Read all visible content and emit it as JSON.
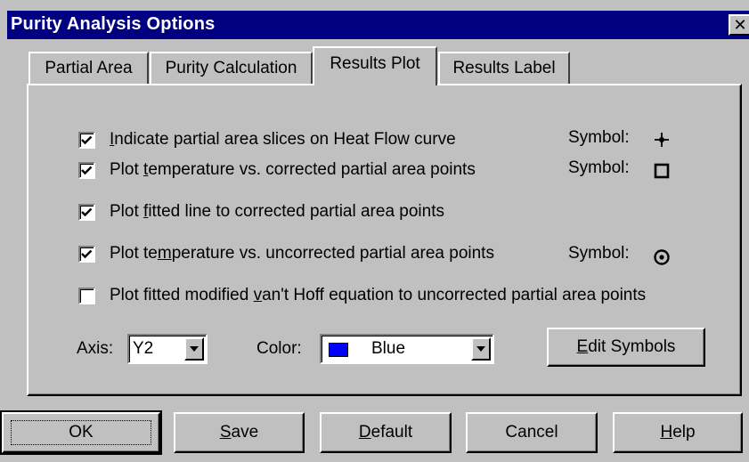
{
  "window": {
    "title": "Purity Analysis Options",
    "close_glyph": "✕"
  },
  "tabs": [
    {
      "label": "Partial Area",
      "active": false
    },
    {
      "label": "Purity Calculation",
      "active": false
    },
    {
      "label": "Results Plot",
      "active": true
    },
    {
      "label": "Results Label",
      "active": false
    }
  ],
  "options": [
    {
      "pre": "",
      "mn": "I",
      "post": "ndicate partial area slices on Heat Flow curve",
      "checked": true,
      "symbol_label": "Symbol:",
      "symbol": "crosshair-icon"
    },
    {
      "pre": "Plot ",
      "mn": "t",
      "post": "emperature vs. corrected partial area points",
      "checked": true,
      "symbol_label": "Symbol:",
      "symbol": "square-icon"
    },
    {
      "pre": "Plot ",
      "mn": "f",
      "post": "itted line to corrected partial area points",
      "checked": true
    },
    {
      "pre": "Plot te",
      "mn": "m",
      "post": "perature vs. uncorrected partial area points",
      "checked": true,
      "symbol_label": "Symbol:",
      "symbol": "target-circle-icon"
    },
    {
      "pre": "Plot fitted modified ",
      "mn": "v",
      "post": "an't Hoff equation to uncorrected partial area points",
      "checked": false
    }
  ],
  "axis": {
    "label": "Axis:",
    "value": "Y2"
  },
  "color": {
    "label": "Color:",
    "value": "Blue",
    "swatch": "#0000ff"
  },
  "edit_symbols": {
    "mn": "E",
    "post": "dit Symbols"
  },
  "buttons": {
    "ok": {
      "pre": "OK",
      "mn": "",
      "post": ""
    },
    "save": {
      "pre": "",
      "mn": "S",
      "post": "ave"
    },
    "default": {
      "pre": "",
      "mn": "D",
      "post": "efault"
    },
    "cancel": {
      "pre": "Cancel",
      "mn": "",
      "post": ""
    },
    "help": {
      "pre": "",
      "mn": "H",
      "post": "elp"
    }
  },
  "colors": {
    "titlebar": "#000080",
    "face": "#c0c0c0",
    "swatch": "#0000ff"
  }
}
